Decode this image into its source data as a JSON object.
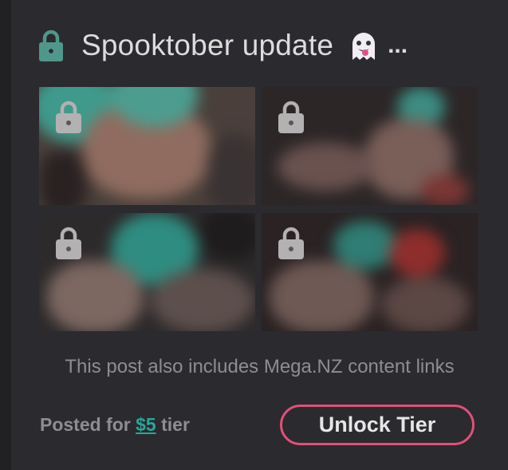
{
  "post": {
    "title": "Spooktober update",
    "title_emoji_icon": "ghost-emoji-icon",
    "title_ellipsis": "...",
    "locked": true
  },
  "gallery": {
    "images": [
      {
        "locked": true,
        "icon": "lock-icon"
      },
      {
        "locked": true,
        "icon": "lock-icon"
      },
      {
        "locked": true,
        "icon": "lock-icon"
      },
      {
        "locked": true,
        "icon": "lock-icon"
      }
    ]
  },
  "note": "This post also includes Mega.NZ content links",
  "footer": {
    "posted_prefix": "Posted for ",
    "tier_amount": "$5",
    "posted_suffix": " tier",
    "unlock_label": "Unlock Tier"
  },
  "colors": {
    "background": "#212124",
    "card": "#2b2a2e",
    "lock_accent": "#4f978b",
    "link": "#2ba59a",
    "button_border": "#e0507a",
    "muted_text": "#8e8e92"
  }
}
